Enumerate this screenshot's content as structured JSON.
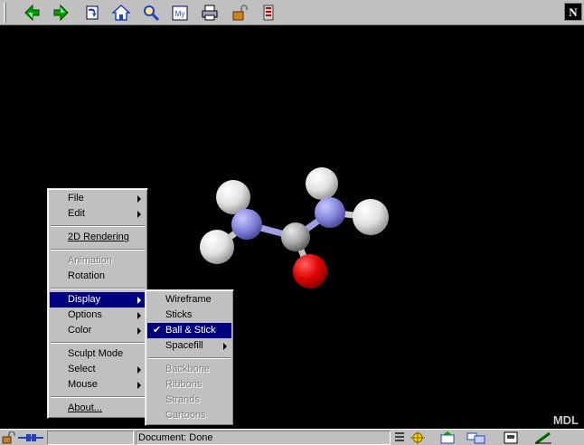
{
  "toolbar": {
    "buttons": [
      {
        "name": "back-icon",
        "color": "#00a000"
      },
      {
        "name": "forward-icon",
        "color": "#00a000"
      },
      {
        "name": "reload-icon",
        "color": "#2040c0"
      },
      {
        "name": "home-icon",
        "color": "#2040c0"
      },
      {
        "name": "search-icon",
        "color": "#ffcc00"
      },
      {
        "name": "my-netscape-icon",
        "label": "My"
      },
      {
        "name": "print-icon",
        "color": "#808080"
      },
      {
        "name": "security-icon",
        "color": "#c06000"
      },
      {
        "name": "stop-icon",
        "color": "#c00000"
      }
    ],
    "logo": "N"
  },
  "viewer": {
    "background": "#000000",
    "watermark": "MDL",
    "molecule": {
      "name_hidden": true,
      "atoms": [
        {
          "element": "H",
          "color": "#e8e8e8"
        },
        {
          "element": "N",
          "color": "#8a8ae0"
        },
        {
          "element": "H",
          "color": "#e8e8e8"
        },
        {
          "element": "C",
          "color": "#b0b0b0"
        },
        {
          "element": "O",
          "color": "#e00000"
        },
        {
          "element": "N",
          "color": "#8a8ae0"
        },
        {
          "element": "H",
          "color": "#e8e8e8"
        },
        {
          "element": "H",
          "color": "#e8e8e8"
        }
      ]
    }
  },
  "context_menu": {
    "items": [
      {
        "label": "File",
        "submenu": true
      },
      {
        "label": "Edit",
        "submenu": true
      },
      {
        "label": "2D Rendering",
        "underline": "2"
      },
      {
        "label": "Animation",
        "disabled": true
      },
      {
        "label": "Rotation"
      },
      {
        "label": "Display",
        "submenu": true,
        "active": true
      },
      {
        "label": "Options",
        "submenu": true
      },
      {
        "label": "Color",
        "submenu": true
      },
      {
        "label": "Sculpt Mode"
      },
      {
        "label": "Select",
        "submenu": true
      },
      {
        "label": "Mouse",
        "submenu": true
      },
      {
        "label": "About...",
        "underline": "A"
      }
    ]
  },
  "display_menu": {
    "items": [
      {
        "label": "Wireframe"
      },
      {
        "label": "Sticks"
      },
      {
        "label": "Ball & Stick",
        "checked": true,
        "active": true
      },
      {
        "label": "Spacefill",
        "submenu": true
      },
      {
        "label": "Backbone",
        "disabled": true
      },
      {
        "label": "Ribbons",
        "disabled": true
      },
      {
        "label": "Strands",
        "disabled": true
      },
      {
        "label": "Cartoons",
        "disabled": true
      }
    ],
    "check_mark": "✔"
  },
  "statusbar": {
    "status_text": "Document: Done"
  }
}
